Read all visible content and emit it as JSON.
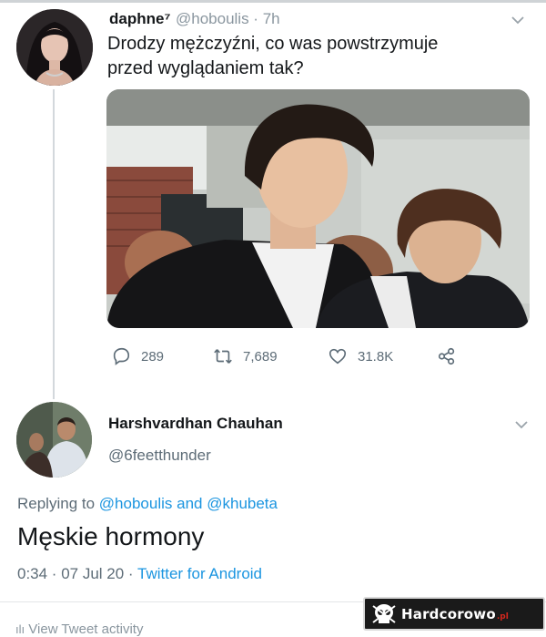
{
  "tweet": {
    "author_name": "daphne⁷",
    "handle_time": "@hoboulis · 7h",
    "text_line1": "Drodzy mężczyźni, co was powstrzymuje",
    "text_line2": "przed wyglądaniem tak?",
    "replies": "289",
    "retweets": "7,689",
    "likes": "31.8K",
    "icons": {
      "reply": "comment-icon",
      "retweet": "retweet-icon",
      "like": "heart-icon",
      "share": "share-icon",
      "menu": "chevron-down-icon"
    }
  },
  "reply": {
    "author_name": "Harshvardhan Chauhan",
    "handle": "@6feetthunder",
    "replying_prefix": "Replying to",
    "replying_user1": "@hoboulis",
    "replying_and": "and",
    "replying_user2": "@khubeta",
    "text": "Męskie hormony",
    "time_date": "0:34 · 07 Jul 20 ·",
    "source": "Twitter for Android",
    "activity": "View Tweet activity"
  },
  "watermark": {
    "text": "Hardcorowo",
    "suffix": ".pl"
  },
  "colors": {
    "link": "#1b95e0",
    "secondary_text": "#5d6c77",
    "primary_text": "#14171a"
  }
}
